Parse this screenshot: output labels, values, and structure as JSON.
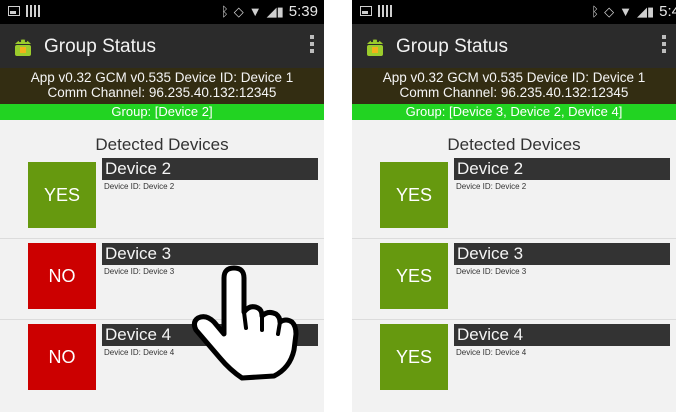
{
  "colors": {
    "yes": "#66990f",
    "no": "#cc0000",
    "group_bar": "#22d322",
    "info_bar": "#332d12",
    "action_bar": "#2b2b2b"
  },
  "phones": [
    {
      "status_time": "5:39",
      "title": "Group Status",
      "info_line1": "App v0.32  GCM v0.535  Device ID: Device 1",
      "info_line2": "Comm Channel: 96.235.40.132:12345",
      "group": "Group: [Device 2]",
      "detected_label": "Detected Devices",
      "devices": [
        {
          "name": "Device 2",
          "id": "Device ID: Device 2",
          "status": "YES"
        },
        {
          "name": "Device 3",
          "id": "Device ID: Device 3",
          "status": "NO"
        },
        {
          "name": "Device 4",
          "id": "Device ID: Device 4",
          "status": "NO"
        }
      ]
    },
    {
      "status_time": "5:4",
      "title": "Group Status",
      "info_line1": "App v0.32  GCM v0.535  Device ID: Device 1",
      "info_line2": "Comm Channel: 96.235.40.132:12345",
      "group": "Group: [Device 3, Device 2, Device 4]",
      "detected_label": "Detected Devices",
      "devices": [
        {
          "name": "Device 2",
          "id": "Device ID: Device 2",
          "status": "YES"
        },
        {
          "name": "Device 3",
          "id": "Device ID: Device 3",
          "status": "YES"
        },
        {
          "name": "Device 4",
          "id": "Device ID: Device 4",
          "status": "YES"
        }
      ]
    }
  ],
  "icons": [
    "gallery-icon",
    "signal-bars-icon",
    "bluetooth-icon",
    "alarm-icon",
    "wifi-icon",
    "battery-icon",
    "android-app-icon",
    "overflow-menu-icon",
    "hand-pointer-icon"
  ]
}
